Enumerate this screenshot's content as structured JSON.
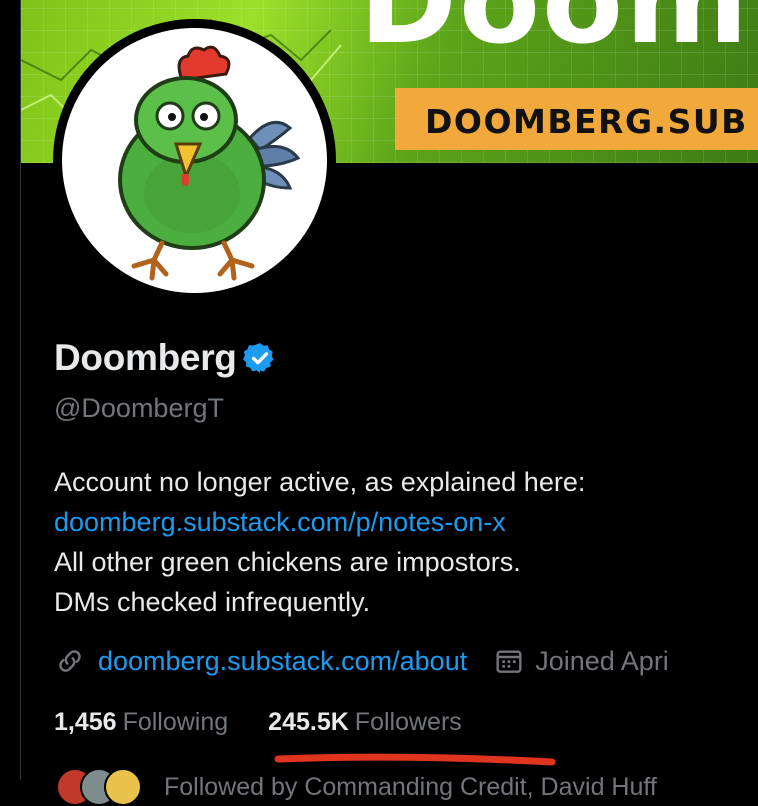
{
  "banner": {
    "title": "Doom",
    "strip_text": "DOOMBERG.SUB",
    "colors": {
      "green": "#7fc319",
      "orange": "#f0a93a"
    }
  },
  "profile": {
    "display_name": "Doomberg",
    "handle": "@DoombergT",
    "verified_icon": "verified-badge-icon",
    "bio": {
      "line1": "Account no longer active, as explained here:",
      "link": "doomberg.substack.com/p/notes-on-x",
      "line3": "All other green chickens are impostors.",
      "line4": "DMs checked infrequently."
    },
    "website": "doomberg.substack.com/about",
    "joined": "Joined Apri"
  },
  "stats": {
    "following_count": "1,456",
    "following_label": "Following",
    "followers_count": "245.5K",
    "followers_label": "Followers"
  },
  "followed_by": {
    "text": "Followed by Commanding Credit, David Huff"
  },
  "colors": {
    "link": "#1d9bf0",
    "muted": "#71767b",
    "text": "#e7e9ea",
    "annotation": "#e0341f"
  }
}
